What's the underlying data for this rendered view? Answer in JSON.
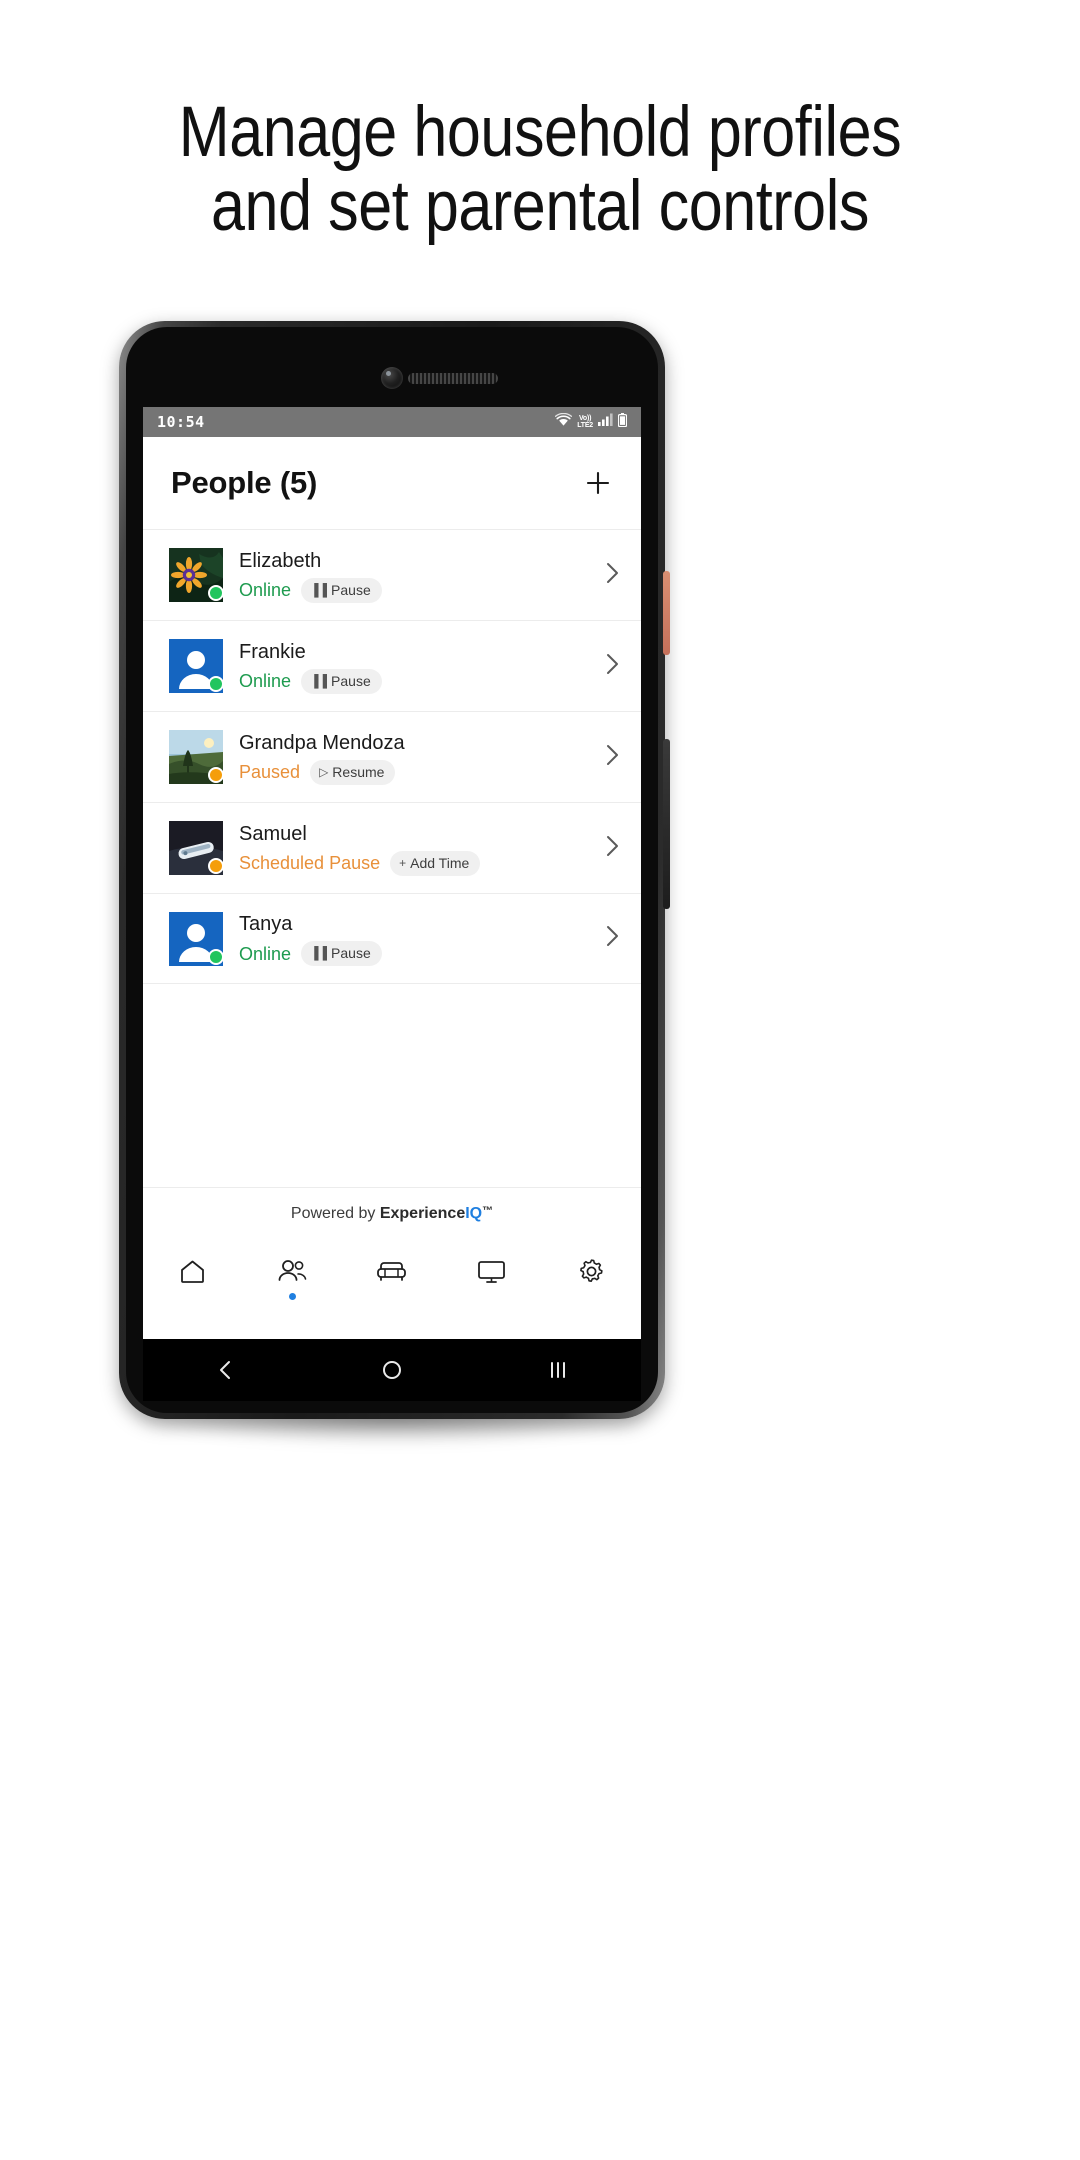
{
  "headline": {
    "line1": "Manage household profiles",
    "line2": "and set parental controls"
  },
  "phone": {
    "status_bar": {
      "time": "10:54",
      "icons": [
        "wifi-icon",
        "volte-icon",
        "signal-icon",
        "battery-icon"
      ],
      "volte_top": "Vo))",
      "volte_bottom": "LTE2",
      "background": "#757575"
    },
    "app": {
      "header": {
        "title": "People (5)",
        "add_label": "+"
      },
      "people": [
        {
          "name": "Elizabeth",
          "status": "Online",
          "status_type": "online",
          "status_color": "#1e9b4f",
          "dot_color": "#22c55e",
          "action_label": "Pause",
          "action_glyph": "▐▐",
          "avatar_type": "photo-flower",
          "chevron": "›"
        },
        {
          "name": "Frankie",
          "status": "Online",
          "status_type": "online",
          "status_color": "#1e9b4f",
          "dot_color": "#22c55e",
          "action_label": "Pause",
          "action_glyph": "▐▐",
          "avatar_type": "default-person",
          "chevron": "›"
        },
        {
          "name": "Grandpa Mendoza",
          "status": "Paused",
          "status_type": "paused",
          "status_color": "#e8903a",
          "dot_color": "#f59e0b",
          "action_label": "Resume",
          "action_glyph": "▷",
          "avatar_type": "photo-landscape",
          "chevron": "›"
        },
        {
          "name": "Samuel",
          "status": "Scheduled Pause",
          "status_type": "paused",
          "status_color": "#e8903a",
          "dot_color": "#f59e0b",
          "action_label": "Add Time",
          "action_glyph": "+",
          "avatar_type": "photo-object",
          "chevron": "›"
        },
        {
          "name": "Tanya",
          "status": "Online",
          "status_type": "online",
          "status_color": "#1e9b4f",
          "dot_color": "#22c55e",
          "action_label": "Pause",
          "action_glyph": "▐▐",
          "avatar_type": "default-person",
          "chevron": "›"
        }
      ],
      "footer": {
        "powered_by": "Powered by ",
        "brand_part1": "Experience",
        "brand_part2": "IQ",
        "brand_trademark": "™"
      },
      "tabs": [
        {
          "name": "home",
          "icon": "home-icon",
          "active": false
        },
        {
          "name": "people",
          "icon": "people-icon",
          "active": true
        },
        {
          "name": "devices",
          "icon": "sofa-icon",
          "active": false
        },
        {
          "name": "network",
          "icon": "monitor-icon",
          "active": false
        },
        {
          "name": "settings",
          "icon": "gear-icon",
          "active": false
        }
      ]
    },
    "android_nav": {
      "back": "back-icon",
      "home": "home-circle-icon",
      "recents": "recents-icon"
    }
  },
  "colors": {
    "accent_blue": "#1f7fe0",
    "online_green": "#1e9b4f",
    "paused_orange": "#e8903a",
    "avatar_blue": "#1565c0",
    "chip_bg": "#f0f0f0"
  }
}
